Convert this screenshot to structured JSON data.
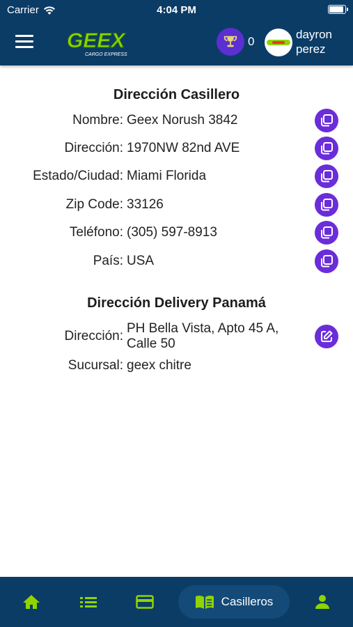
{
  "status": {
    "carrier": "Carrier",
    "time": "4:04 PM"
  },
  "header": {
    "logo_text": "GEEX",
    "logo_subtext": "CARGO EXPRESS",
    "trophy_count": "0",
    "user_first": "dayron",
    "user_last": "perez"
  },
  "casillero": {
    "title": "Dirección Casillero",
    "rows": [
      {
        "label": "Nombre:",
        "value": "Geex Norush 3842"
      },
      {
        "label": "Dirección:",
        "value": "1970NW 82nd AVE"
      },
      {
        "label": "Estado/Ciudad:",
        "value": "Miami Florida"
      },
      {
        "label": "Zip Code:",
        "value": "33126"
      },
      {
        "label": "Teléfono:",
        "value": "(305) 597-8913"
      },
      {
        "label": "País:",
        "value": "USA"
      }
    ]
  },
  "delivery": {
    "title": "Dirección Delivery Panamá",
    "address_label": "Dirección:",
    "address_value": "PH Bella Vista, Apto 45 A, Calle 50",
    "branch_label": "Sucursal:",
    "branch_value": "geex chitre"
  },
  "nav": {
    "active_label": "Casilleros"
  },
  "colors": {
    "primary": "#0b3c66",
    "accent": "#6a2dd9",
    "green": "#8fd400"
  }
}
